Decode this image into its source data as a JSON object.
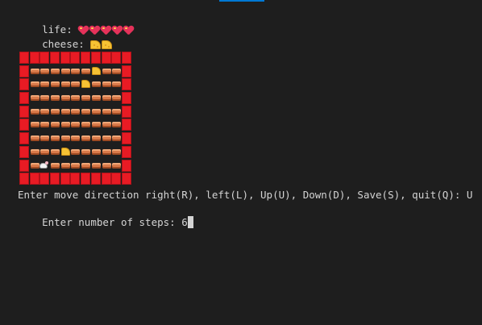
{
  "tab": {
    "label": ""
  },
  "status": {
    "life_label": "life: ",
    "life_icon": "sparkling-heart-icon",
    "life_count": 5,
    "cheese_label": "cheese: ",
    "cheese_icon": "cheese-icon",
    "cheese_count": 2
  },
  "maze": {
    "legend": {
      "W": "wall-icon",
      "B": "brick-floor-icon",
      "C": "cheese-icon",
      "M": "mouse-icon"
    },
    "rows": [
      "WWWWWWWWWWW",
      "WBBBBBBCBBW",
      "WBBBBBCBBBW",
      "WBBBBBBBBBW",
      "WBBBBBBBBBW",
      "WBBBBBBBBBW",
      "WBBBBBBBBBW",
      "WBBBCBBBBBW",
      "WBMBBBBBBBW",
      "WWWWWWWWWWW"
    ]
  },
  "prompt": {
    "direction": "Enter move direction right(R), left(L), Up(U), Down(D), Save(S), quit(Q): U",
    "steps_label": "Enter number of steps: ",
    "steps_value": "6"
  },
  "colors": {
    "background": "#1e1e1e",
    "text": "#d4d4d4",
    "wall": "#e81b24",
    "brick": "#d97a4a",
    "cheese": "#f6c234",
    "heart": "#e5325a",
    "tab_accent": "#0078d4"
  }
}
